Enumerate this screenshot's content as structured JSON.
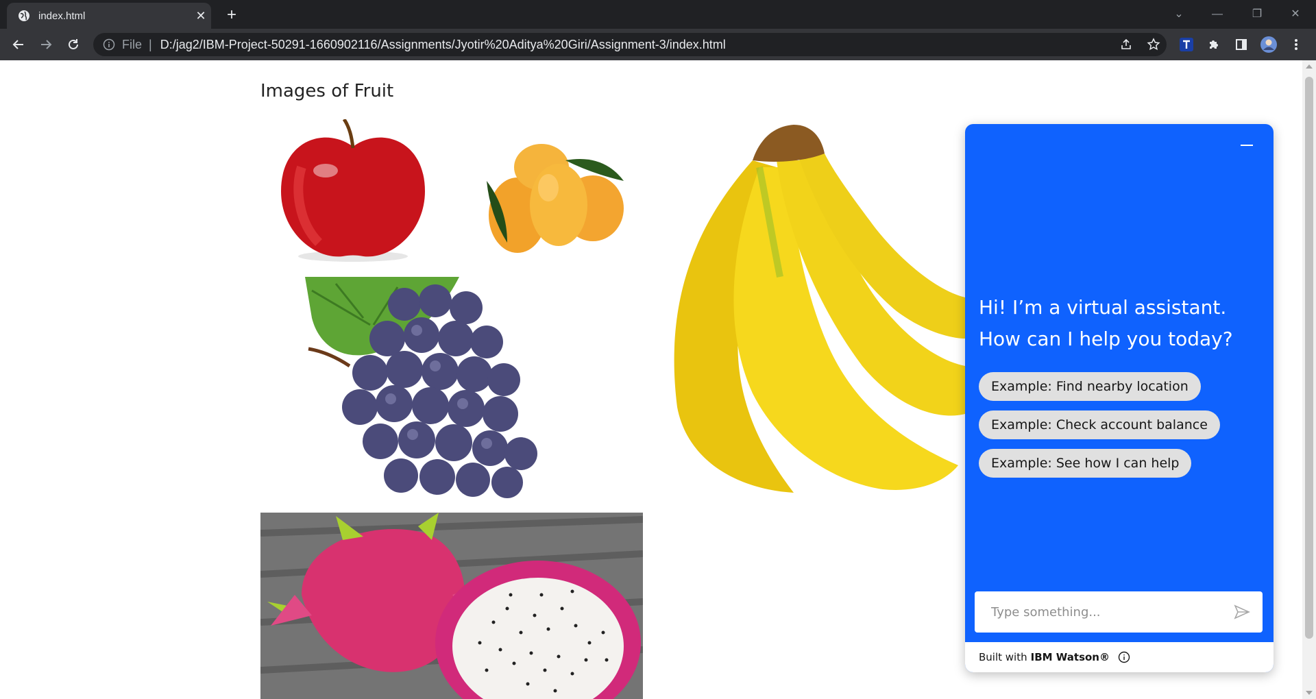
{
  "browser": {
    "tab_title": "index.html",
    "tab_close": "✕",
    "new_tab": "+",
    "scheme_label": "File",
    "separator": "|",
    "url": "D:/jag2/IBM-Project-50291-1660902116/Assignments/Jyotir%20Aditya%20Giri/Assignment-3/index.html",
    "window_controls": [
      "⌄",
      "—",
      "❐",
      "✕"
    ]
  },
  "page": {
    "title": "Images of Fruit",
    "images": [
      {
        "name": "apple",
        "alt": "apple"
      },
      {
        "name": "mango",
        "alt": "mango"
      },
      {
        "name": "banana",
        "alt": "banana"
      },
      {
        "name": "grapes",
        "alt": "grapes"
      },
      {
        "name": "dragon-fruit",
        "alt": "dragon fruit"
      }
    ]
  },
  "chat": {
    "greeting": "Hi! I’m a virtual assistant. How can I help you today?",
    "chips": [
      "Example: Find nearby location",
      "Example: Check account balance",
      "Example: See how I can help"
    ],
    "input_placeholder": "Type something...",
    "footer_built": "Built with",
    "footer_brand": "IBM Watson®",
    "accent_color": "#0f62fe"
  }
}
